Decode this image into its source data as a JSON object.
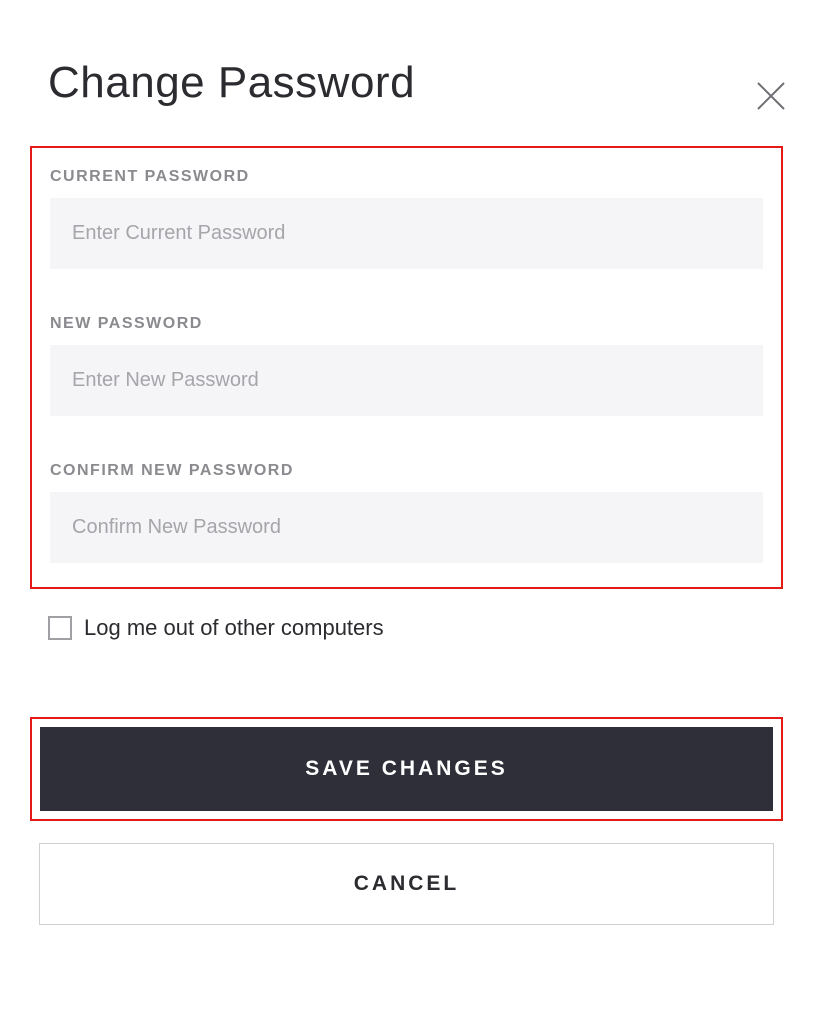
{
  "title": "Change Password",
  "fields": {
    "current": {
      "label": "CURRENT PASSWORD",
      "placeholder": "Enter Current Password",
      "value": ""
    },
    "new": {
      "label": "NEW PASSWORD",
      "placeholder": "Enter New Password",
      "value": ""
    },
    "confirm": {
      "label": "CONFIRM NEW PASSWORD",
      "placeholder": "Confirm New Password",
      "value": ""
    }
  },
  "checkbox": {
    "label": "Log me out of other computers",
    "checked": false
  },
  "buttons": {
    "save": "SAVE CHANGES",
    "cancel": "CANCEL"
  },
  "colors": {
    "highlight_border": "#e61919",
    "primary_button_bg": "#2f2f3a",
    "input_bg": "#f5f5f7",
    "label_color": "#8a8a8f"
  }
}
